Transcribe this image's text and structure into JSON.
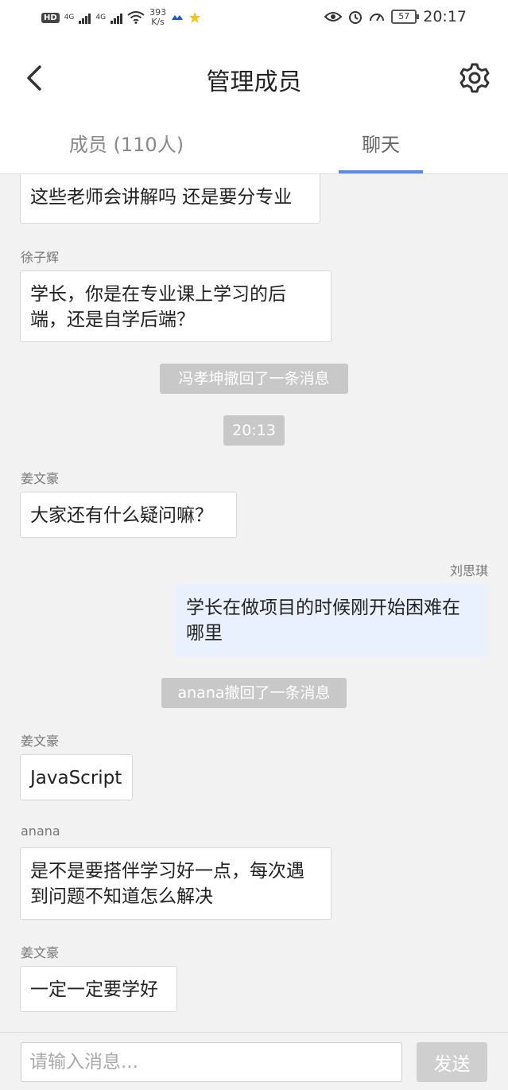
{
  "status_bar": {
    "hd": "HD",
    "net1": "4G",
    "net2": "4G",
    "speed_value": "393",
    "speed_unit": "K/s",
    "battery": "57",
    "time": "20:17"
  },
  "header": {
    "title": "管理成员",
    "back_icon": "chevron-left-icon",
    "settings_icon": "gear-icon"
  },
  "tabs": [
    {
      "label": "成员 (110人)",
      "active": false
    },
    {
      "label": "聊天",
      "active": true
    }
  ],
  "messages": [
    {
      "type": "text",
      "side": "left",
      "sender": "",
      "text": "这些老师会讲解吗 还是要分专业"
    },
    {
      "type": "text",
      "side": "left",
      "sender": "徐子辉",
      "text": "学长，你是在专业课上学习的后端，还是自学后端？"
    },
    {
      "type": "notice",
      "text": "冯孝坤撤回了一条消息"
    },
    {
      "type": "time",
      "text": "20:13"
    },
    {
      "type": "text",
      "side": "left",
      "sender": "姜文豪",
      "text": "大家还有什么疑问嘛？"
    },
    {
      "type": "text",
      "side": "right",
      "sender": "刘思琪",
      "text": "学长在做项目的时候刚开始困难在哪里"
    },
    {
      "type": "notice",
      "text": "anana撤回了一条消息"
    },
    {
      "type": "text",
      "side": "left",
      "sender": "姜文豪",
      "text": "JavaScript"
    },
    {
      "type": "text",
      "side": "left",
      "sender": "anana",
      "text": "是不是要搭伴学习好一点，每次遇到问题不知道怎么解决"
    },
    {
      "type": "text",
      "side": "left",
      "sender": "姜文豪",
      "text": "一定一定要学好"
    }
  ],
  "input": {
    "placeholder": "请输入消息...",
    "value": "",
    "send_label": "发送"
  },
  "colors": {
    "accent": "#5a8be8",
    "self_bubble": "#e8f1fd",
    "notice_bg": "#c8c8c8"
  }
}
